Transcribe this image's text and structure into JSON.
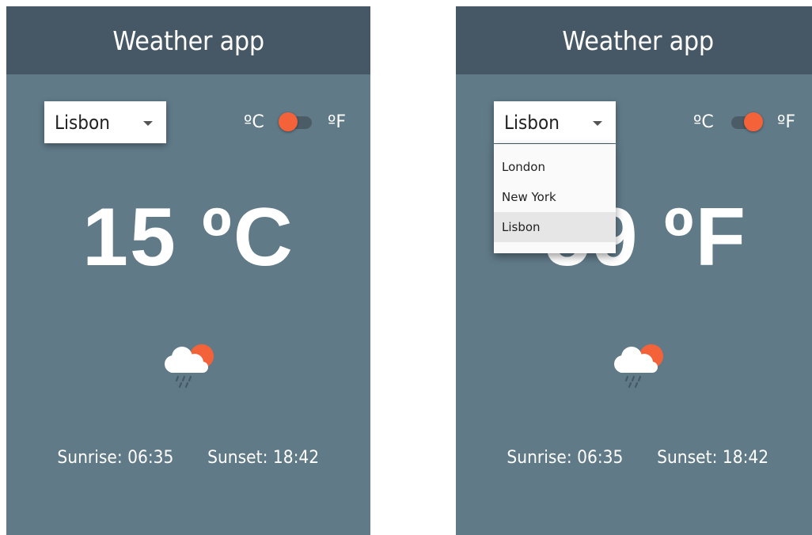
{
  "screens": [
    {
      "app_title": "Weather app",
      "city": "Lisbon",
      "unit_c_label": "ºC",
      "unit_f_label": "ºF",
      "unit_toggle": "ºC",
      "temperature": "15 ºC",
      "weather_icon": "cloud-rain-sun-icon",
      "sunrise": "Sunrise: 06:35",
      "sunset": "Sunset: 18:42"
    },
    {
      "app_title": "Weather app",
      "city": "Lisbon",
      "unit_c_label": "ºC",
      "unit_f_label": "ºF",
      "unit_toggle": "ºF",
      "temperature": "59 ºF",
      "weather_icon": "cloud-rain-sun-icon",
      "sunrise": "Sunrise: 06:35",
      "sunset": "Sunset: 18:42",
      "dropdown": {
        "open": true,
        "options": [
          "London",
          "New York",
          "Lisbon"
        ],
        "selected": "Lisbon"
      }
    }
  ],
  "colors": {
    "appbar": "#465865",
    "background": "#607a88",
    "accent": "#f4623a",
    "white": "#ffffff"
  }
}
